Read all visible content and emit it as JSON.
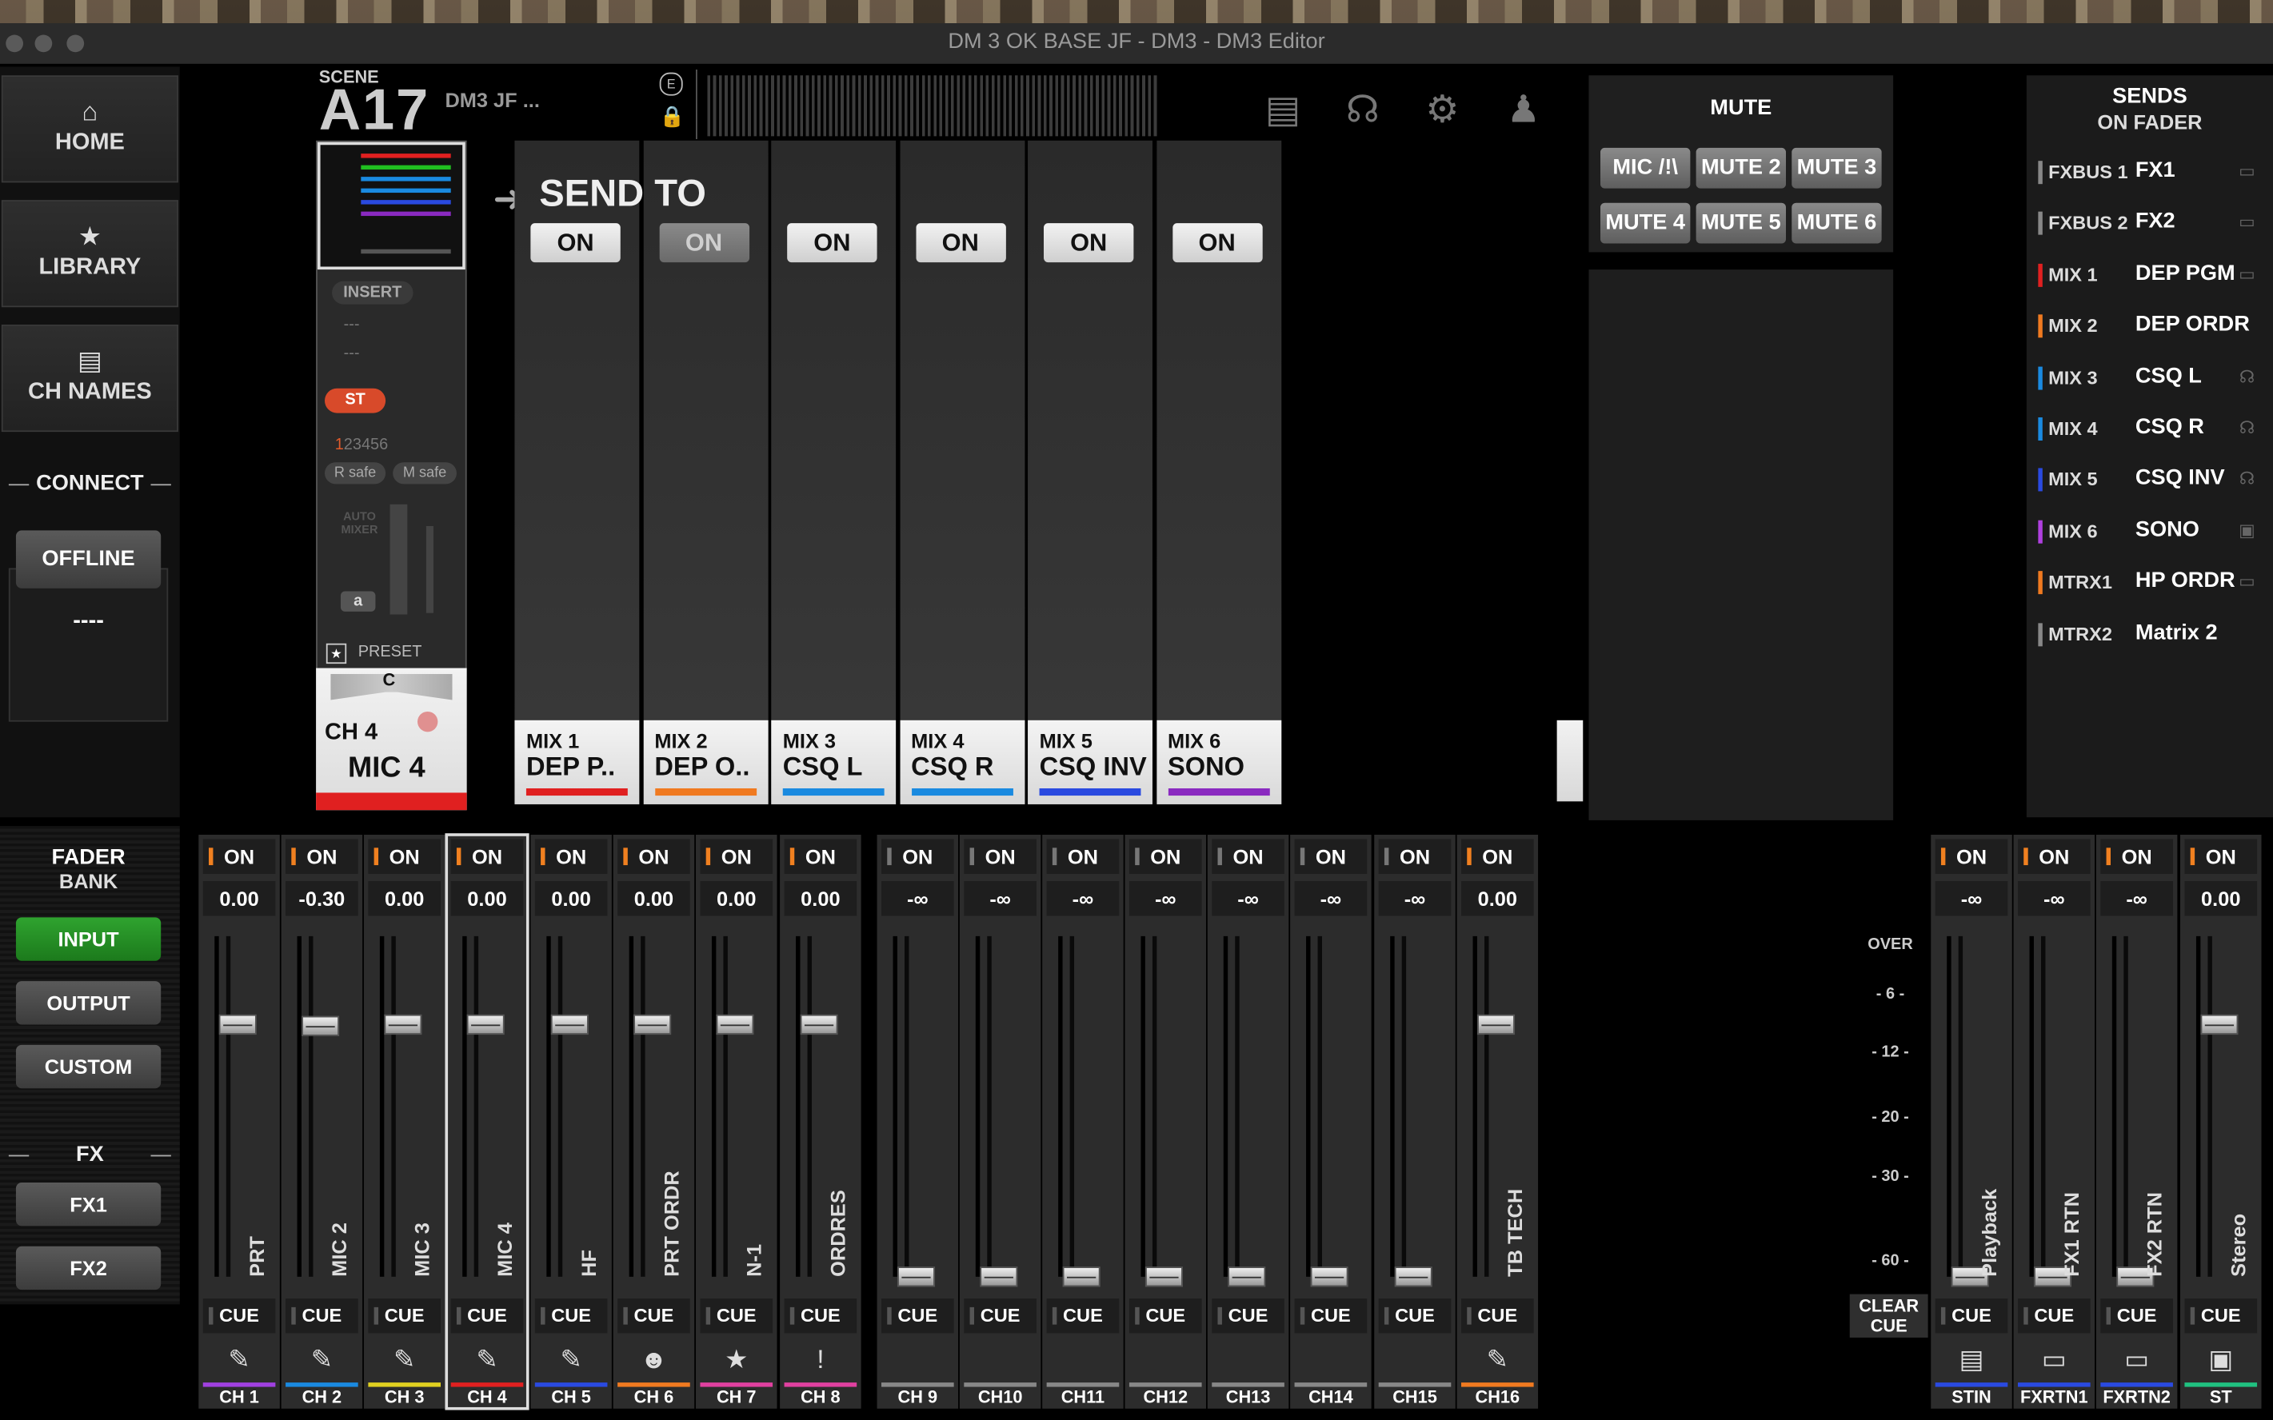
{
  "window": {
    "title": "DM 3 OK BASE JF - DM3 - DM3 Editor"
  },
  "nav": {
    "home": "HOME",
    "library": "LIBRARY",
    "ch_names": "CH NAMES",
    "connect": "CONNECT",
    "offline": "OFFLINE",
    "status": "----"
  },
  "fader_bank": {
    "title": "FADER",
    "subtitle": "BANK",
    "input": "INPUT",
    "output": "OUTPUT",
    "custom": "CUSTOM"
  },
  "fx": {
    "title": "FX",
    "fx1": "FX1",
    "fx2": "FX2"
  },
  "scene": {
    "label": "SCENE",
    "number": "A17",
    "title": "DM3 JF ..."
  },
  "channel": {
    "insert": "INSERT",
    "slot1": "---",
    "slot2": "---",
    "st": "ST",
    "dca_first": "1",
    "dca_rest": "23456",
    "r_safe": "R safe",
    "m_safe": "M safe",
    "auto_mixer": "AUTO MIXER",
    "a": "a",
    "preset": "PRESET",
    "pan": "C",
    "ch": "CH 4",
    "name": "MIC 4"
  },
  "send_to": {
    "title": "SEND TO",
    "columns": [
      {
        "on": "ON",
        "active": true,
        "mix": "MIX 1",
        "name": "DEP P..",
        "color": "#e02020"
      },
      {
        "on": "ON",
        "active": false,
        "mix": "MIX 2",
        "name": "DEP O..",
        "color": "#f07a20"
      },
      {
        "on": "ON",
        "active": true,
        "mix": "MIX 3",
        "name": "CSQ L",
        "color": "#1a8ae0"
      },
      {
        "on": "ON",
        "active": true,
        "mix": "MIX 4",
        "name": "CSQ R",
        "color": "#1a8ae0"
      },
      {
        "on": "ON",
        "active": true,
        "mix": "MIX 5",
        "name": "CSQ INV",
        "color": "#2a4ae0"
      },
      {
        "on": "ON",
        "active": true,
        "mix": "MIX 6",
        "name": "SONO",
        "color": "#8a2ac0"
      }
    ]
  },
  "mute": {
    "title": "MUTE",
    "buttons": [
      "MIC /!\\",
      "MUTE 2",
      "MUTE 3",
      "MUTE 4",
      "MUTE 5",
      "MUTE 6"
    ]
  },
  "sends": {
    "title": "SENDS",
    "subtitle": "ON FADER",
    "rows": [
      {
        "key": "FXBUS 1",
        "name": "FX1",
        "color": "#888",
        "icon": "fx-icon"
      },
      {
        "key": "FXBUS 2",
        "name": "FX2",
        "color": "#888",
        "icon": "fx-icon"
      },
      {
        "key": "MIX 1",
        "name": "DEP PGM",
        "color": "#e02020",
        "icon": "monitor-icon"
      },
      {
        "key": "MIX 2",
        "name": "DEP ORDR",
        "color": "#f07a20",
        "icon": ""
      },
      {
        "key": "MIX 3",
        "name": "CSQ L",
        "color": "#1a8ae0",
        "icon": "headphones-icon"
      },
      {
        "key": "MIX 4",
        "name": "CSQ R",
        "color": "#1a8ae0",
        "icon": "headphones-icon"
      },
      {
        "key": "MIX 5",
        "name": "CSQ INV",
        "color": "#2a4ae0",
        "icon": "headphones-icon"
      },
      {
        "key": "MIX 6",
        "name": "SONO",
        "color": "#b040e0",
        "icon": "speaker-icon"
      },
      {
        "key": "MTRX1",
        "name": "HP ORDR",
        "color": "#f07a20",
        "icon": "monitor-icon"
      },
      {
        "key": "MTRX2",
        "name": "Matrix 2",
        "color": "#888",
        "icon": ""
      }
    ]
  },
  "strips": [
    {
      "on": "ON",
      "val": "0.00",
      "name": "PRT",
      "lbl": "CH 1",
      "color": "#a040e0",
      "icon": "mic-icon",
      "level": 0.76,
      "active": true
    },
    {
      "on": "ON",
      "val": "-0.30",
      "name": "MIC 2",
      "lbl": "CH 2",
      "color": "#1a8ae0",
      "icon": "mic-icon",
      "level": 0.755,
      "active": true
    },
    {
      "on": "ON",
      "val": "0.00",
      "name": "MIC 3",
      "lbl": "CH 3",
      "color": "#e0d020",
      "icon": "mic-icon",
      "level": 0.76,
      "active": true
    },
    {
      "on": "ON",
      "val": "0.00",
      "name": "MIC 4",
      "lbl": "CH 4",
      "color": "#e02020",
      "icon": "mic-icon",
      "level": 0.76,
      "active": true,
      "sel": true
    },
    {
      "on": "ON",
      "val": "0.00",
      "name": "HF",
      "lbl": "CH 5",
      "color": "#2a4ae0",
      "icon": "mic-icon",
      "level": 0.76,
      "active": true
    },
    {
      "on": "ON",
      "val": "0.00",
      "name": "PRT ORDR",
      "lbl": "CH 6",
      "color": "#f07a20",
      "icon": "talk-icon",
      "level": 0.76,
      "active": true
    },
    {
      "on": "ON",
      "val": "0.00",
      "name": "N-1",
      "lbl": "CH 7",
      "color": "#e040a0",
      "icon": "star-icon",
      "level": 0.76,
      "active": true
    },
    {
      "on": "ON",
      "val": "0.00",
      "name": "ORDRES",
      "lbl": "CH 8",
      "color": "#e040a0",
      "icon": "exclaim-icon",
      "level": 0.76,
      "active": true
    },
    {
      "on": "ON",
      "val": "-∞",
      "name": "",
      "lbl": "CH 9",
      "color": "#888",
      "icon": "",
      "level": 0.0,
      "active": false
    },
    {
      "on": "ON",
      "val": "-∞",
      "name": "",
      "lbl": "CH10",
      "color": "#888",
      "icon": "",
      "level": 0.0,
      "active": false
    },
    {
      "on": "ON",
      "val": "-∞",
      "name": "",
      "lbl": "CH11",
      "color": "#888",
      "icon": "",
      "level": 0.0,
      "active": false
    },
    {
      "on": "ON",
      "val": "-∞",
      "name": "",
      "lbl": "CH12",
      "color": "#888",
      "icon": "",
      "level": 0.0,
      "active": false
    },
    {
      "on": "ON",
      "val": "-∞",
      "name": "",
      "lbl": "CH13",
      "color": "#888",
      "icon": "",
      "level": 0.0,
      "active": false
    },
    {
      "on": "ON",
      "val": "-∞",
      "name": "",
      "lbl": "CH14",
      "color": "#888",
      "icon": "",
      "level": 0.0,
      "active": false
    },
    {
      "on": "ON",
      "val": "-∞",
      "name": "",
      "lbl": "CH15",
      "color": "#888",
      "icon": "",
      "level": 0.0,
      "active": false
    },
    {
      "on": "ON",
      "val": "0.00",
      "name": "TB TECH",
      "lbl": "CH16",
      "color": "#f07a20",
      "icon": "mic-icon",
      "level": 0.76,
      "active": true
    },
    {
      "on": "ON",
      "val": "-∞",
      "name": "Playback",
      "lbl": "STIN",
      "color": "#2a4ae0",
      "icon": "usb-icon",
      "level": 0.0,
      "active": true
    },
    {
      "on": "ON",
      "val": "-∞",
      "name": "FX1 RTN",
      "lbl": "FXRTN1",
      "color": "#2a4ae0",
      "icon": "fx-icon",
      "level": 0.0,
      "active": true
    },
    {
      "on": "ON",
      "val": "-∞",
      "name": "FX2 RTN",
      "lbl": "FXRTN2",
      "color": "#2a4ae0",
      "icon": "fx-icon",
      "level": 0.0,
      "active": true
    },
    {
      "on": "ON",
      "val": "0.00",
      "name": "Stereo",
      "lbl": "ST",
      "color": "#20c080",
      "icon": "speaker-icon",
      "level": 0.76,
      "active": true
    }
  ],
  "meter_scale": [
    "OVER",
    "- 6 -",
    "- 12 -",
    "- 20 -",
    "- 30 -",
    "- 60 -"
  ],
  "cue": "CUE",
  "clear_cue": "CLEAR CUE"
}
